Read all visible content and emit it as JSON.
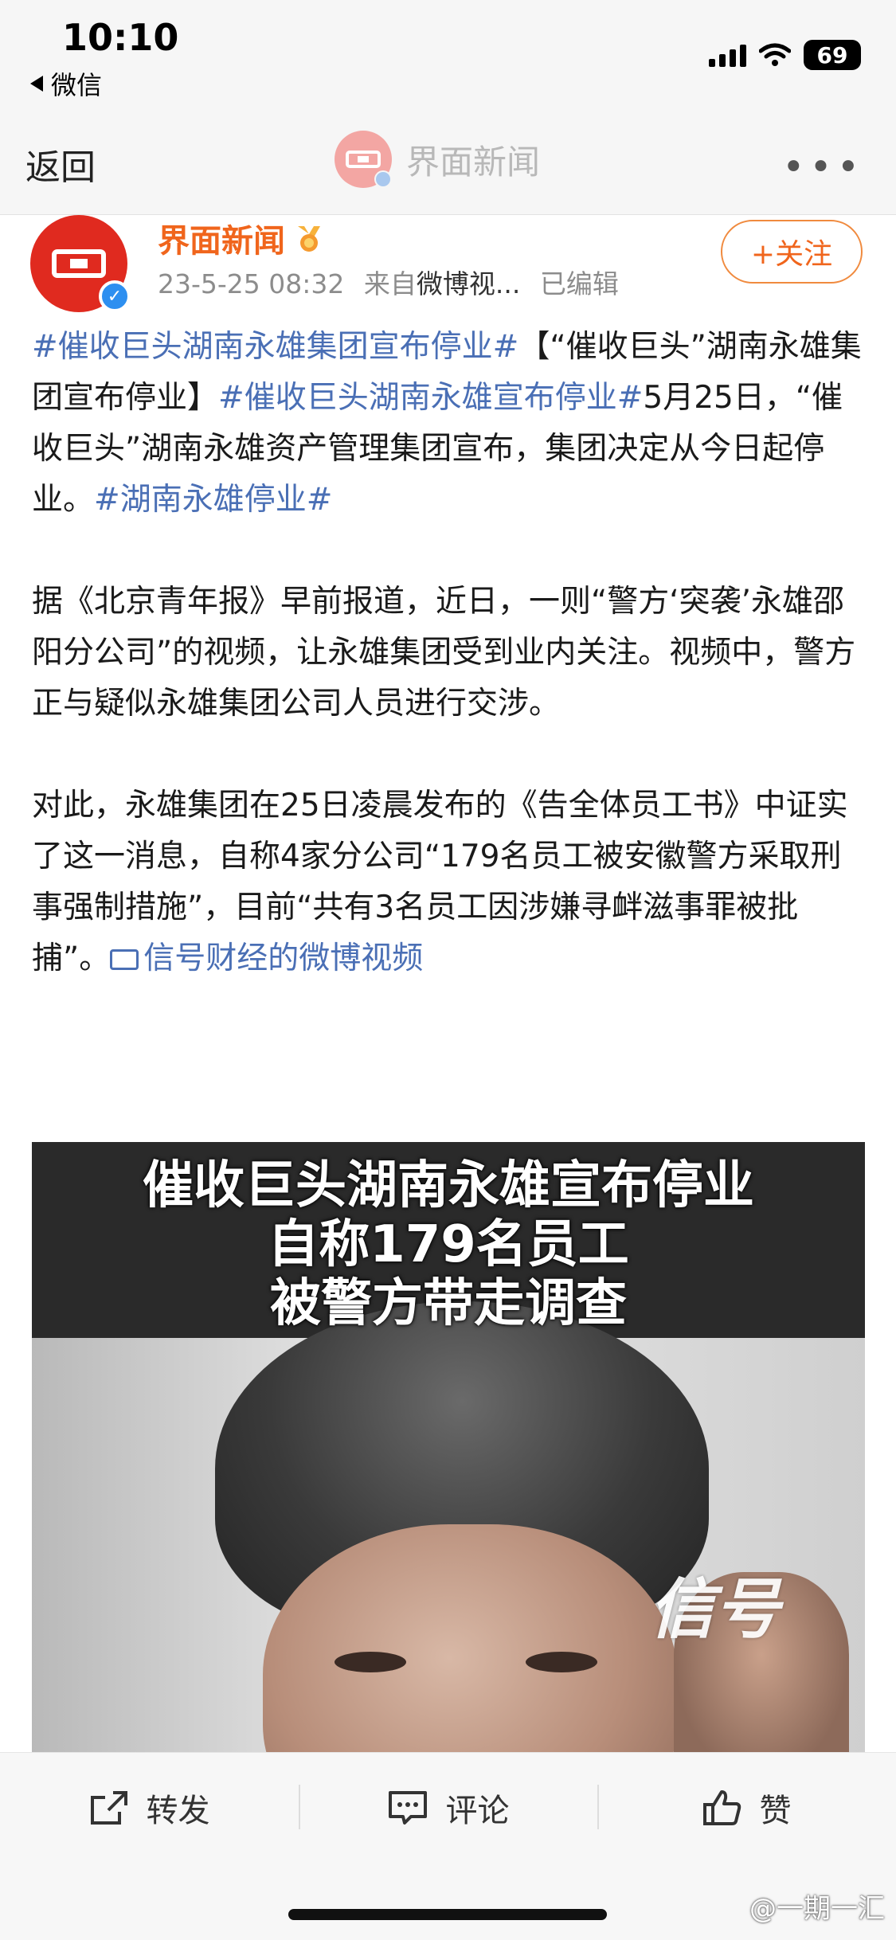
{
  "status_bar": {
    "time": "10:10",
    "back_app": "微信",
    "battery": "69"
  },
  "nav": {
    "back": "返回",
    "title": "界面新闻",
    "more": "•••"
  },
  "post": {
    "author": "界面新闻",
    "date": "23-5-25 08:32",
    "from_label": "来自",
    "source": "微博视...",
    "edited": "已编辑",
    "follow": "+关注"
  },
  "content": {
    "p1_tag1": "#催收巨头湖南永雄集团宣布停业#",
    "p1_text1": "【“催收巨头”湖南永雄集团宣布停业】",
    "p1_tag2": "#催收巨头湖南永雄宣布停业#",
    "p1_text2": "5月25日，“催收巨头”湖南永雄资产管理集团宣布，集团决定从今日起停业。",
    "p1_tag3": "#湖南永雄停业#",
    "p2": "据《北京青年报》早前报道，近日，一则“警方‘突袭’永雄邵阳分公司”的视频，让永雄集团受到业内关注。视频中，警方正与疑似永雄集团公司人员进行交涉。",
    "p3": "对此，永雄集团在25日凌晨发布的《告全体员工书》中证实了这一消息，自称4家分公司“179名员工被安徽警方采取刑事强制措施”，目前“共有3名员工因涉嫌寻衅滋事罪被批捕”。",
    "video_link": "信号财经的微博视频"
  },
  "video": {
    "caption_line1": "催收巨头湖南永雄宣布停业",
    "caption_line2": "自称179名员工",
    "caption_line3": "被警方带走调查",
    "logo": "信号"
  },
  "actions": {
    "repost": "转发",
    "comment": "评论",
    "like": "赞"
  },
  "watermark": "@一期一汇",
  "colors": {
    "accent_orange": "#f0651c",
    "link_blue": "#4a6fb5",
    "brand_red": "#e02a1f"
  },
  "icons": {
    "repost": "share-box-icon",
    "comment": "comment-bubble-icon",
    "like": "thumbs-up-icon"
  }
}
